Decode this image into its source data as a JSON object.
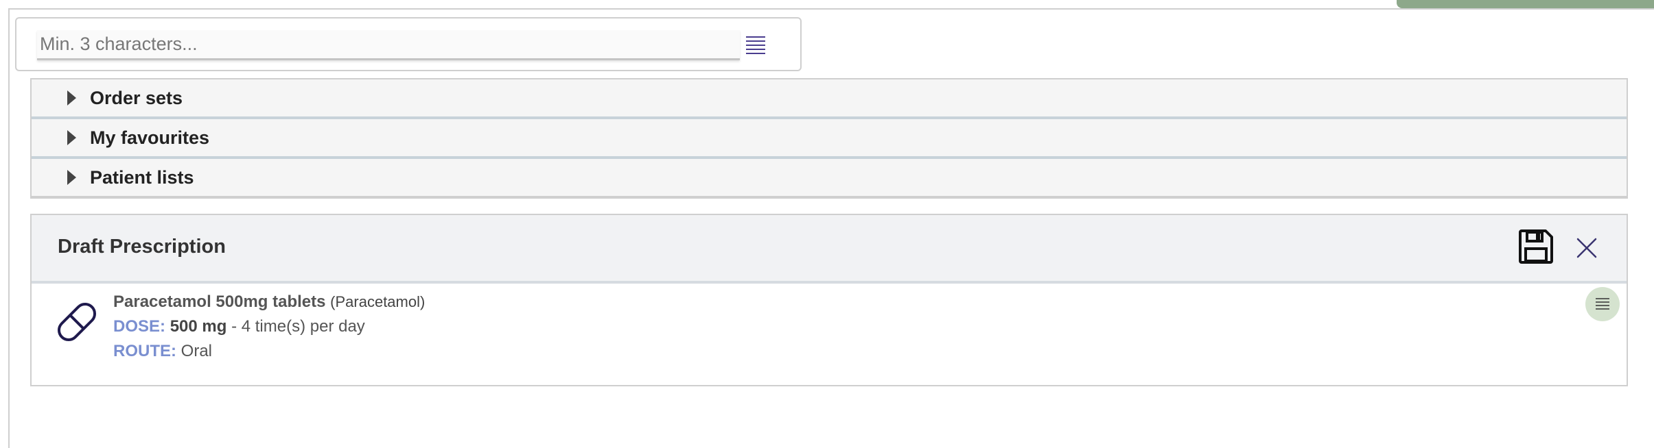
{
  "search": {
    "placeholder": "Min. 3 characters...",
    "menu_icon": "list-icon"
  },
  "accordion": {
    "items": [
      {
        "label": "Order sets"
      },
      {
        "label": "My favourites"
      },
      {
        "label": "Patient lists"
      }
    ]
  },
  "draft": {
    "title": "Draft Prescription",
    "save_icon": "floppy-disk-icon",
    "close_icon": "close-icon",
    "item": {
      "icon": "pill-icon",
      "name": "Paracetamol 500mg tablets",
      "generic": "(Paracetamol)",
      "dose_label": "DOSE:",
      "dose_value": "500 mg",
      "frequency": "- 4 time(s) per day",
      "route_label": "ROUTE:",
      "route_value": "Oral",
      "menu_icon": "list-icon"
    }
  },
  "colors": {
    "accent_green": "#8da88a",
    "label_blue": "#7a8fd0",
    "menu_bubble": "#d5e3cf",
    "icon_navy": "#1f1a4d"
  }
}
